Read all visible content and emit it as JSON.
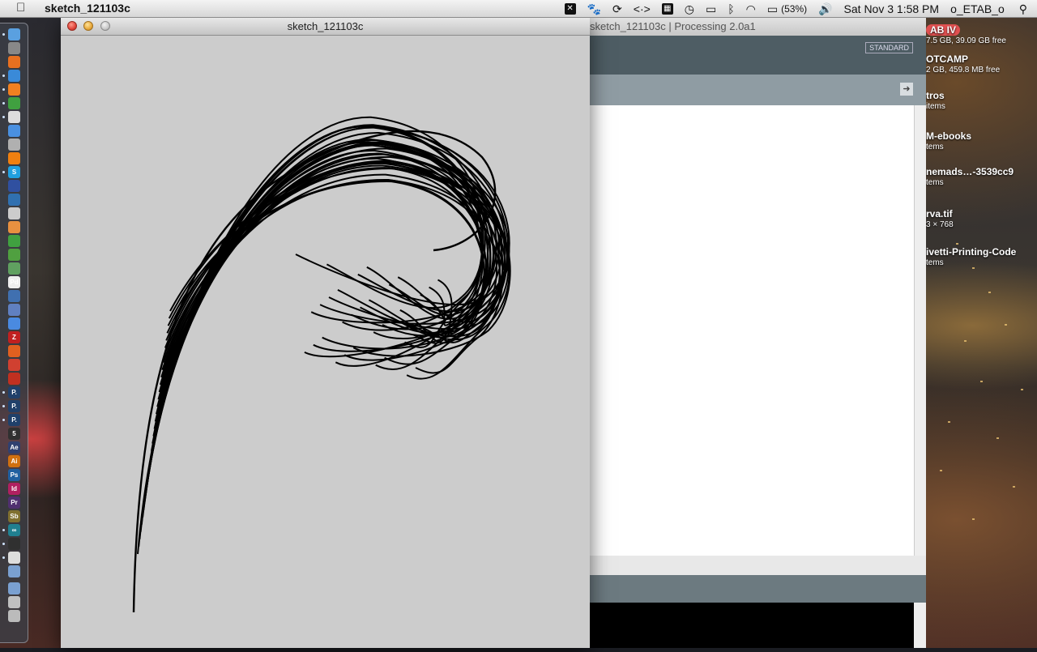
{
  "menubar": {
    "apple_icon": "apple-icon",
    "app_name": "sketch_121103c",
    "battery": "(53%)",
    "datetime": "Sat Nov 3  1:58 PM",
    "user": "o_ETAB_o"
  },
  "sketch_window": {
    "title": "sketch_121103c"
  },
  "editor_window": {
    "title": "sketch_121103c | Processing 2.0a1",
    "mode": "STANDARD",
    "tab_arrow": "➜"
  },
  "desktop": {
    "items": [
      {
        "name": "AB IV",
        "sub": "7.5 GB, 39.09 GB free"
      },
      {
        "name": "OTCAMP",
        "sub": "2 GB, 459.8 MB free"
      },
      {
        "name": "tros",
        "sub": "items"
      },
      {
        "name": "M-ebooks",
        "sub": "tems"
      },
      {
        "name": "nemads…-3539cc9",
        "sub": "tems"
      },
      {
        "name": "rva.tif",
        "sub": "3 × 768"
      },
      {
        "name": "ivetti-Printing-Code",
        "sub": "tems"
      }
    ]
  },
  "dock": {
    "icons": [
      {
        "name": "finder-icon",
        "color": "#5aa0e0",
        "glyph": ""
      },
      {
        "name": "system-prefs-icon",
        "color": "#888888",
        "glyph": ""
      },
      {
        "name": "firefox-icon",
        "color": "#e87020",
        "glyph": ""
      },
      {
        "name": "safari-icon",
        "color": "#3a8ad8",
        "glyph": ""
      },
      {
        "name": "pages-icon",
        "color": "#f08020",
        "glyph": ""
      },
      {
        "name": "chrome-icon",
        "color": "#40a040",
        "glyph": ""
      },
      {
        "name": "mail-icon",
        "color": "#dddddd",
        "glyph": ""
      },
      {
        "name": "itunes-icon",
        "color": "#4a90e0",
        "glyph": ""
      },
      {
        "name": "iphoto-icon",
        "color": "#b0b0b0",
        "glyph": ""
      },
      {
        "name": "vlc-icon",
        "color": "#f08010",
        "glyph": ""
      },
      {
        "name": "skype-icon",
        "color": "#20a0e0",
        "glyph": "S"
      },
      {
        "name": "network-icon",
        "color": "#3050a0",
        "glyph": ""
      },
      {
        "name": "drive-icon",
        "color": "#3070b0",
        "glyph": ""
      },
      {
        "name": "textedit-icon",
        "color": "#cccccc",
        "glyph": ""
      },
      {
        "name": "burn-icon",
        "color": "#e89040",
        "glyph": ""
      },
      {
        "name": "grapher-icon",
        "color": "#40a040",
        "glyph": ""
      },
      {
        "name": "cyberduck-icon",
        "color": "#50a040",
        "glyph": ""
      },
      {
        "name": "activity-icon",
        "color": "#60a060",
        "glyph": ""
      },
      {
        "name": "pd-icon",
        "color": "#eeeeee",
        "glyph": "Pd"
      },
      {
        "name": "launchpad-icon",
        "color": "#4070b0",
        "glyph": ""
      },
      {
        "name": "preview-icon",
        "color": "#6080c0",
        "glyph": ""
      },
      {
        "name": "ichat-icon",
        "color": "#4a8ae0",
        "glyph": ""
      },
      {
        "name": "filezilla-icon",
        "color": "#c02020",
        "glyph": "Z"
      },
      {
        "name": "firefox-alt-icon",
        "color": "#e06020",
        "glyph": ""
      },
      {
        "name": "scrivener-icon",
        "color": "#d04030",
        "glyph": ""
      },
      {
        "name": "acrobat-icon",
        "color": "#c03020",
        "glyph": ""
      },
      {
        "name": "processing-icon-1",
        "color": "#20406a",
        "glyph": "P."
      },
      {
        "name": "processing-icon-2",
        "color": "#20406a",
        "glyph": "P."
      },
      {
        "name": "processing-icon-3",
        "color": "#20406a",
        "glyph": "P."
      },
      {
        "name": "five-icon",
        "color": "#303030",
        "glyph": "5"
      },
      {
        "name": "after-effects-icon",
        "color": "#304070",
        "glyph": "Ae"
      },
      {
        "name": "illustrator-icon",
        "color": "#d07010",
        "glyph": "Ai"
      },
      {
        "name": "photoshop-icon",
        "color": "#2060a0",
        "glyph": "Ps"
      },
      {
        "name": "indesign-icon",
        "color": "#b02060",
        "glyph": "Id"
      },
      {
        "name": "premiere-icon",
        "color": "#503070",
        "glyph": "Pr"
      },
      {
        "name": "soundbooth-icon",
        "color": "#807030",
        "glyph": "Sb"
      },
      {
        "name": "arduino-icon",
        "color": "#208090",
        "glyph": "∞"
      },
      {
        "name": "terminal-icon",
        "color": "#303030",
        "glyph": ""
      },
      {
        "name": "script-icon",
        "color": "#dddddd",
        "glyph": ""
      },
      {
        "name": "applications-folder-icon",
        "color": "#7aa0d0",
        "glyph": ""
      },
      {
        "name": "documents-folder-icon",
        "color": "#7aa0d0",
        "glyph": ""
      },
      {
        "name": "downloads-icon",
        "color": "#c0c0c0",
        "glyph": ""
      },
      {
        "name": "trash-icon",
        "color": "#bbbbbb",
        "glyph": ""
      }
    ]
  }
}
